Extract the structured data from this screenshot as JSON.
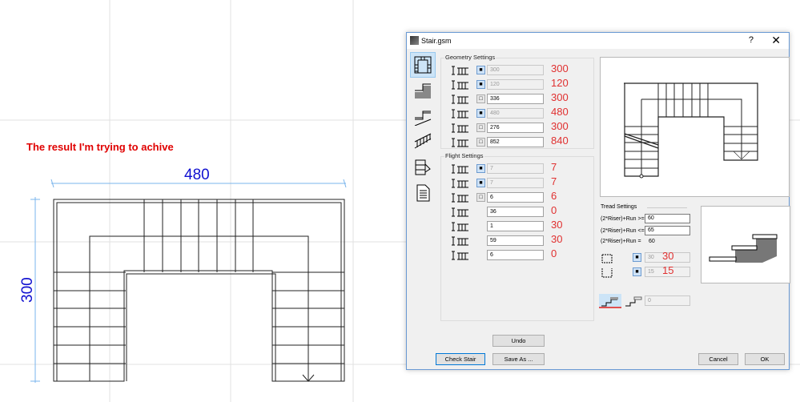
{
  "annotation": {
    "note": "The result I'm trying to achive",
    "dim_width": "480",
    "dim_height": "300"
  },
  "dialog": {
    "title": "Stair.gsm",
    "help": "?",
    "close": "✕",
    "geometry": {
      "label": "Geometry Settings",
      "rows": [
        {
          "icon": "stair-height-icon",
          "locked": true,
          "value": "300",
          "disabled": true,
          "annotation": "300"
        },
        {
          "icon": "stair-width-icon",
          "locked": true,
          "value": "120",
          "disabled": true,
          "annotation": "120"
        },
        {
          "icon": "flight-length-icon",
          "locked": false,
          "value": "336",
          "disabled": false,
          "annotation": "300"
        },
        {
          "icon": "total-width-icon",
          "locked": true,
          "value": "480",
          "disabled": true,
          "annotation": "480"
        },
        {
          "icon": "landing-depth-icon",
          "locked": false,
          "value": "276",
          "disabled": false,
          "annotation": "300"
        },
        {
          "icon": "walkline-length-icon",
          "locked": false,
          "value": "852",
          "disabled": false,
          "annotation": "840"
        }
      ]
    },
    "flight": {
      "label": "Flight Settings",
      "rows": [
        {
          "icon": "riser-count-icon",
          "lock": "locked",
          "value": "7",
          "disabled": true,
          "annotation": "7"
        },
        {
          "icon": "tread-count-icon",
          "lock": "locked",
          "value": "7",
          "disabled": true,
          "annotation": "7"
        },
        {
          "icon": "winder-count-icon",
          "lock": "open",
          "value": "6",
          "disabled": false,
          "annotation": "6"
        },
        {
          "icon": "offset-icon",
          "lock": "none",
          "value": "36",
          "disabled": false,
          "annotation": "0"
        },
        {
          "icon": "start-step-icon",
          "lock": "none",
          "value": "1",
          "disabled": false,
          "annotation": "30"
        },
        {
          "icon": "end-step-icon",
          "lock": "none",
          "value": "59",
          "disabled": false,
          "annotation": "30"
        },
        {
          "icon": "first-step-icon",
          "lock": "none",
          "value": "6",
          "disabled": false,
          "annotation": "0"
        }
      ]
    },
    "tread": {
      "label": "Tread Settings",
      "min_label": "(2*Riser)+Run >=",
      "min_value": "60",
      "max_label": "(2*Riser)+Run <=",
      "max_value": "65",
      "eq_label": "(2*Riser)+Run =",
      "eq_value": "60",
      "tread_depth": "30",
      "tread_depth_annotation": "30",
      "riser_height": "15",
      "riser_height_annotation": "15",
      "nosing_value": "0"
    },
    "buttons": {
      "undo": "Undo",
      "check": "Check Stair",
      "save_as": "Save As ...",
      "cancel": "Cancel",
      "ok": "OK"
    }
  }
}
